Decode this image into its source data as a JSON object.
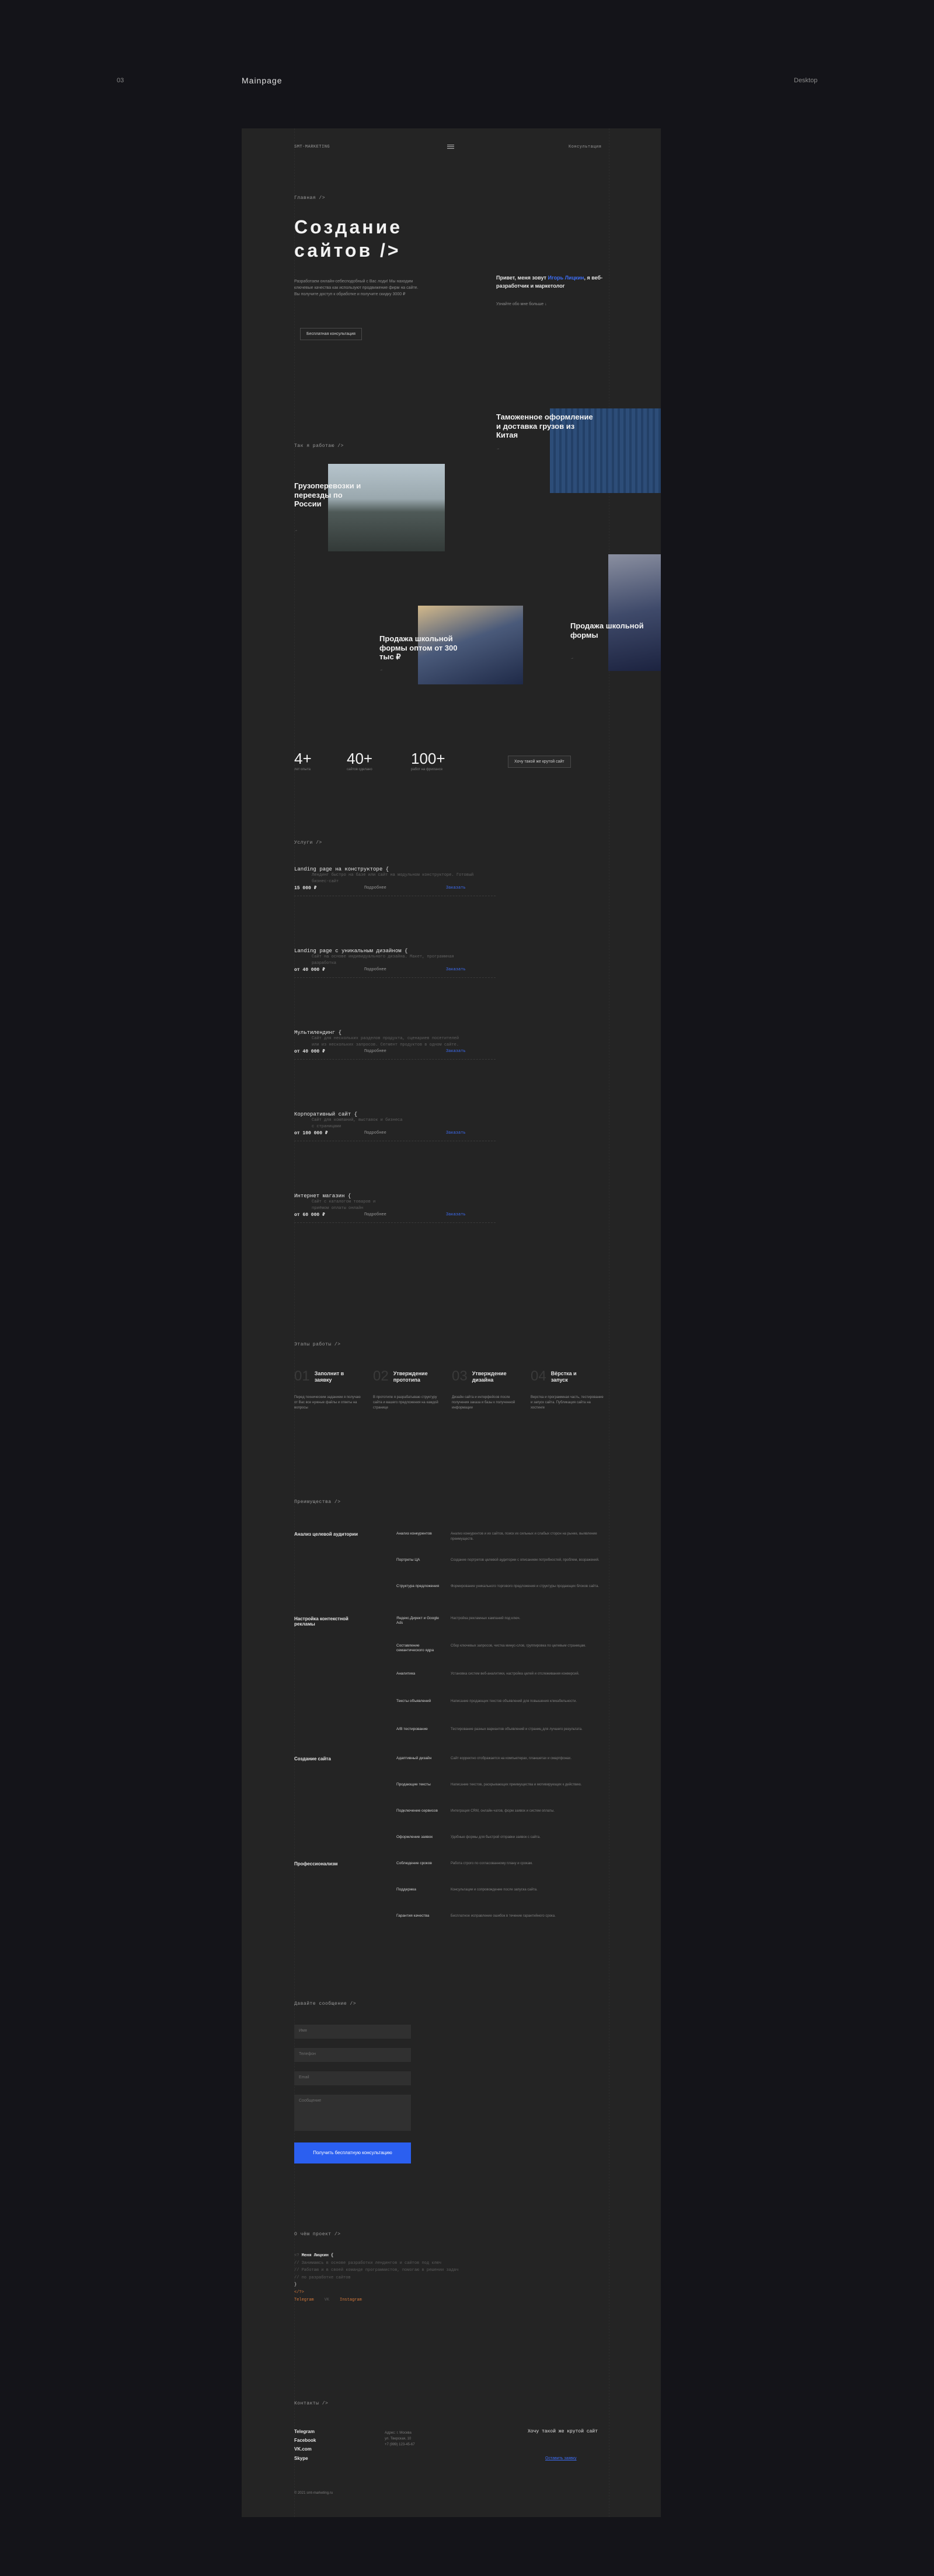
{
  "canvas": {
    "page_number": "03",
    "page_name": "Mainpage",
    "device": "Desktop"
  },
  "header": {
    "logo": "SMT-MARKETING",
    "menu_icon": "hamburger-icon",
    "consult_link": "Консультация"
  },
  "hero": {
    "breadcrumb": "Главная />",
    "title_line1": "Создание",
    "title_line2": "сайтов />",
    "text": "Разработаем онлайн-себесподобный с Вас лоди! Мы находим ключевые качества как используют продвижение фирм на сайте. Вы получите доступ к обработке и получите скидку 3000 ₽",
    "cta": "Бесплатная консультация",
    "aside_text_1": "Привет, меня зовут ",
    "aside_name": "Игорь Лицкин",
    "aside_text_2": ", я веб-разработчик и маркетолог",
    "aside_more": "Узнайте обо мне больше ↓"
  },
  "cases": {
    "label": "Так я работаю />",
    "items": [
      {
        "title": "Грузоперевозки и переезды по России",
        "more": "→"
      },
      {
        "title": "Таможенное оформление и доставка грузов из Китая",
        "more": "→"
      },
      {
        "title": "Продажа школьной формы оптом от 300 тыс ₽",
        "more": "→"
      },
      {
        "title": "Продажа школьной формы",
        "more": "→"
      }
    ]
  },
  "stats": {
    "items": [
      {
        "num": "4+",
        "label": "лет опыта"
      },
      {
        "num": "40+",
        "label": "сайтов сделано"
      },
      {
        "num": "100+",
        "label": "работ на фрилансе"
      }
    ],
    "cta": "Хочу такой же крутой сайт"
  },
  "services": {
    "label": "Услуги />",
    "items": [
      {
        "name": "Landing page на конструкторе {",
        "desc1": "Лендинг быстро на базе или сайт на модульном конструкторе. Готовый",
        "desc2": "бизнес-сайт",
        "price": "15 000 ₽",
        "more": "Подробнее",
        "link": "Заказать"
      },
      {
        "name": "Landing page с уникальным дизайном {",
        "desc1": "Сайт на основе индивидуального дизайна. Макет, программная",
        "desc2": "разработка",
        "price": "от 40 000 ₽",
        "more": "Подробнее",
        "link": "Заказать"
      },
      {
        "name": "Мультилендинг {",
        "desc1": "Сайт для нескольких разделов продукта, сценариев посетителей",
        "desc2": "или из нескольких запросов. Сегмент продуктов в одном сайте.",
        "price": "от 40 000 ₽",
        "more": "Подробнее",
        "link": "Заказать"
      },
      {
        "name": "Корпоративный сайт {",
        "desc1": "Сайт для компаний, выставок и бизнеса",
        "desc2": "с страницами",
        "price": "от 100 000 ₽",
        "more": "Подробнее",
        "link": "Заказать"
      },
      {
        "name": "Интернет магазин {",
        "desc1": "Сайт с каталогом товаров и",
        "desc2": "приёмом оплаты онлайн",
        "price": "от 60 000 ₽",
        "more": "Подробнее",
        "link": "Заказать"
      }
    ]
  },
  "process": {
    "label": "Этапы работы />",
    "items": [
      {
        "num": "01",
        "title": "Заполнит в заявку",
        "text": "Перед техническим заданием я получаю от Вас все нужные файлы и ответы на вопросы"
      },
      {
        "num": "02",
        "title": "Утверждение прототипа",
        "text": "В прототипе я разрабатываю структуру сайта и вашего предложения на каждой странице"
      },
      {
        "num": "03",
        "title": "Утверждение дизайна",
        "text": "Дизайн сайта и интерфейсов после получения заказа и базы к полученной информации"
      },
      {
        "num": "04",
        "title": "Вёрстка и запуск",
        "text": "Верстка и программная часть, тестирование и запуск сайта. Публикация сайта на хостинге"
      }
    ]
  },
  "benefits": {
    "label": "Преимущества />",
    "groups": [
      {
        "title": "Анализ целевой аудитории",
        "items": [
          {
            "name": "Анализ конкурентов",
            "desc": "Анализ конкурентов и их сайтов, поиск их сильных и слабых сторон на рынке, выявление преимуществ."
          },
          {
            "name": "Портреты ЦА",
            "desc": "Создание портретов целевой аудитории с описанием потребностей, проблем, возражений."
          },
          {
            "name": "Структура предложения",
            "desc": "Формирование уникального торгового предложения и структуры продающих блоков сайта."
          }
        ]
      },
      {
        "title": "Настройка контекстной рекламы",
        "items": [
          {
            "name": "Яндекс.Директ и Google Ads",
            "desc": "Настройка рекламных кампаний под ключ."
          },
          {
            "name": "Составление семантического ядра",
            "desc": "Сбор ключевых запросов, чистка минус-слов, группировка по целевым страницам."
          },
          {
            "name": "Аналитика",
            "desc": "Установка систем веб-аналитики, настройка целей и отслеживания конверсий."
          },
          {
            "name": "Тексты объявлений",
            "desc": "Написание продающих текстов объявлений для повышения кликабельности."
          },
          {
            "name": "A/B тестирование",
            "desc": "Тестирование разных вариантов объявлений и страниц для лучшего результата."
          }
        ]
      },
      {
        "title": "Создание сайта",
        "items": [
          {
            "name": "Адаптивный дизайн",
            "desc": "Сайт корректно отображается на компьютерах, планшетах и смартфонах."
          },
          {
            "name": "Продающие тексты",
            "desc": "Написание текстов, раскрывающих преимущества и мотивирующих к действию."
          },
          {
            "name": "Подключение сервисов",
            "desc": "Интеграция CRM, онлайн-чатов, форм заявок и систем оплаты."
          },
          {
            "name": "Оформление заявок",
            "desc": "Удобные формы для быстрой отправки заявок с сайта."
          }
        ]
      },
      {
        "title": "Профессионализм",
        "items": [
          {
            "name": "Соблюдение сроков",
            "desc": "Работа строго по согласованному плану и срокам."
          },
          {
            "name": "Поддержка",
            "desc": "Консультации и сопровождение после запуска сайта."
          },
          {
            "name": "Гарантия качества",
            "desc": "Бесплатное исправление ошибок в течение гарантийного срока."
          }
        ]
      }
    ]
  },
  "form": {
    "label": "Давайте сообщение />",
    "name_ph": "Имя",
    "phone_ph": "Телефон",
    "email_ph": "Email",
    "msg_ph": "Сообщение",
    "submit": "Получить бесплатную консультацию"
  },
  "about": {
    "label": "О чём проект />",
    "lines": [
      {
        "pre": "<?",
        "text": " Меня Лицкин {"
      },
      {
        "pre": "// ",
        "text": "Занимаюсь в основе разработки лендингов и сайтов под ключ"
      },
      {
        "pre": "// ",
        "text": "Работаю и в своей команде программистов, помогаю в решении задач"
      },
      {
        "pre": "// ",
        "text": "по разработке сайтов"
      },
      {
        "pre": "",
        "text": "}"
      },
      {
        "pre": "",
        "text": "</?>"
      }
    ],
    "links": [
      "Telegram",
      "VK",
      "Instagram"
    ]
  },
  "footer": {
    "label": "Контакты />",
    "contacts": [
      "Telegram",
      "Facebook",
      "VK.com",
      "Skype"
    ],
    "addr1": "Адрес: г. Москва",
    "addr2": "ул. Тверская, 10",
    "addr3": "+7 (999) 123-45-67",
    "cta": "Хочу такой же крутой сайт",
    "cta_link": "Оставить заявку",
    "copy": "© 2021 smt-marketing.ru"
  }
}
